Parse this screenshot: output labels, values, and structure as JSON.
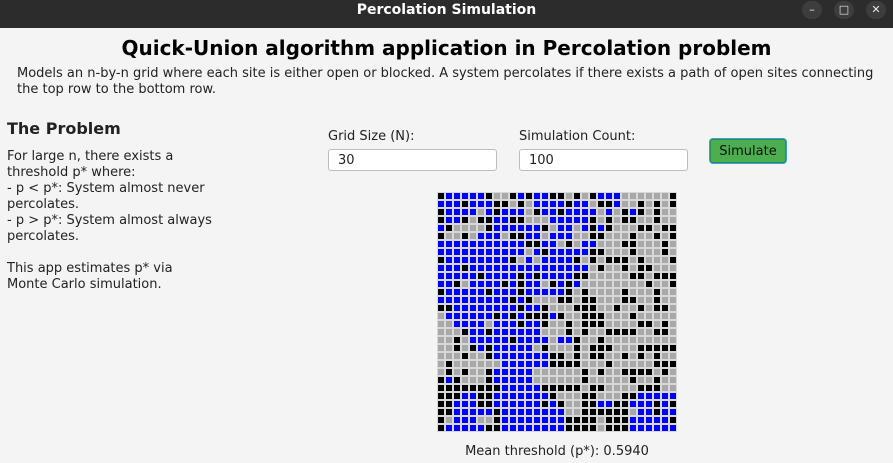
{
  "window": {
    "title": "Percolation Simulation"
  },
  "header": {
    "title": "Quick-Union algorithm application in Percolation problem",
    "description": "Models an n-by-n grid where each site is either open or blocked. A system percolates if there exists a path of open sites connecting the top row to the bottom row."
  },
  "sidebar": {
    "title": "The Problem",
    "text": "For large n, there exists a threshold p* where:\n- p < p*: System almost never percolates.\n- p > p*: System almost always percolates.\n\nThis app estimates p* via Monte Carlo simulation."
  },
  "controls": {
    "grid_size_label": "Grid Size (N):",
    "grid_size_value": "30",
    "sim_count_label": "Simulation Count:",
    "sim_count_value": "100",
    "simulate_label": "Simulate"
  },
  "grid": {
    "size": 30,
    "legend": {
      "0": "blocked",
      "1": "full",
      "2": "open"
    },
    "rows": [
      "011111022010110020201112222220",
      "111011100202111101120012202020",
      "011112101112011011112120102022",
      "011020011002221111102020022022",
      "102222011111102112101022200200",
      "022021112001121112200222022020",
      "111111111110011202112220022202",
      "111111111112101111100222022202",
      "011111111021211110202000202220",
      "111011111111111111120220200222",
      "111110111101011110022222002000",
      "110211110101120101222222220220",
      "011111011101111102022220222022",
      "111111111010222002002220022022",
      "001111111101102220002202202002",
      "211111101010001022000222022222",
      "221111211101102202000222200202",
      "222011011111122202022000022002",
      "220211111011112110220222222222",
      "220201011111202220200022200000",
      "222022011111110020200220202022",
      "202222221111110000222022222000",
      "202022011111222222020220000202",
      "010222011111222222022222022022",
      "000000001111100000200222200022",
      "000110011111110222002220011111",
      "001110011111101022001100111010",
      "001111101111111122000000211011",
      "021112201111111100002000111110",
      "011111001111111100002000111111"
    ]
  },
  "result": {
    "mean_threshold": "Mean threshold (p*): 0.5940"
  },
  "colors": {
    "blocked": "#000000",
    "full": "#0000ff",
    "open": "#a8a8a8",
    "button": "#4cae4f",
    "titlebar": "#2c2c2c"
  },
  "icons": {
    "minimize": "minimize-icon",
    "maximize": "maximize-icon",
    "close": "close-icon"
  }
}
